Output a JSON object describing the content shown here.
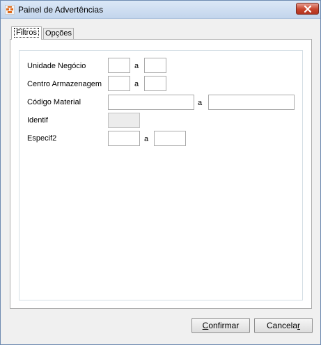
{
  "window": {
    "title": "Painel de Advertências",
    "icon": "app-icon",
    "close_icon": "close-icon"
  },
  "tabs": [
    {
      "label": "Filtros",
      "active": true
    },
    {
      "label": "Opções",
      "active": false
    }
  ],
  "filters": {
    "unidade_negocio": {
      "label": "Unidade Negócio",
      "from_value": "",
      "separator": "a",
      "to_value": ""
    },
    "centro_armazenagem": {
      "label": "Centro Armazenagem",
      "from_value": "",
      "separator": "a",
      "to_value": ""
    },
    "codigo_material": {
      "label": "Código Material",
      "from_value": "",
      "separator": "a",
      "to_value": ""
    },
    "identif": {
      "label": "Identif",
      "value": "",
      "enabled": false
    },
    "especif2": {
      "label": "Especif2",
      "from_value": "",
      "separator": "a",
      "to_value": ""
    }
  },
  "buttons": {
    "confirm": {
      "label_prefix": "",
      "label_mnemonic": "C",
      "label_rest": "onfirmar"
    },
    "cancel": {
      "label_prefix": "Cancela",
      "label_mnemonic": "r",
      "label_rest": ""
    }
  }
}
